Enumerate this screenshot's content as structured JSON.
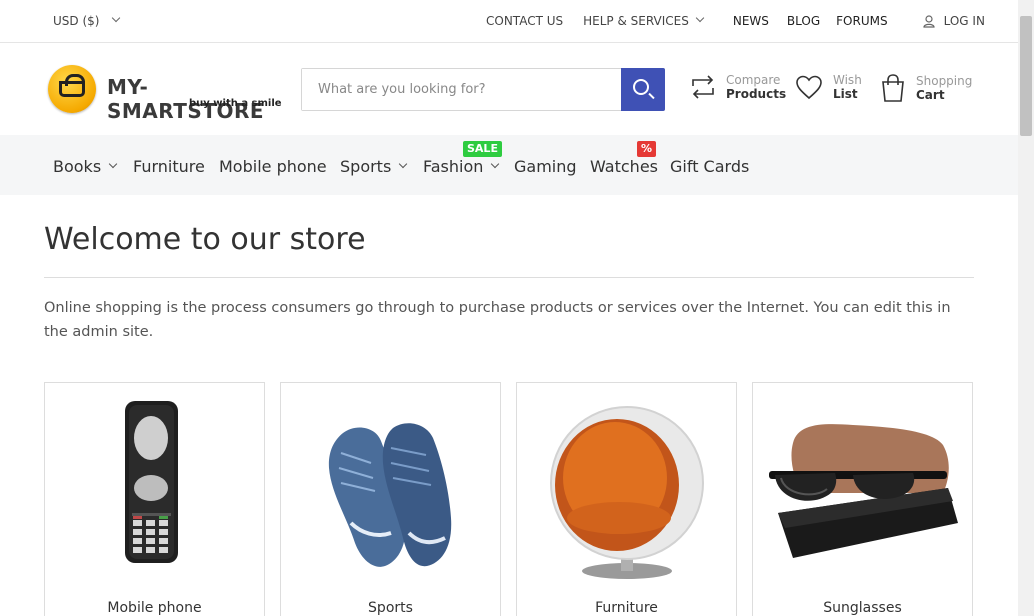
{
  "topbar": {
    "currency": "USD ($)",
    "contact": "CONTACT US",
    "help": "HELP & SERVICES",
    "news": "NEWS",
    "blog": "BLOG",
    "forums": "FORUMS",
    "login": "LOG IN"
  },
  "header": {
    "logo_name": "MY-SMARTSTORE",
    "logo_tagline": "buy with a smile",
    "search_placeholder": "What are you looking for?",
    "compare_small": "Compare",
    "compare_big": "Products",
    "wish_small": "Wish",
    "wish_big": "List",
    "cart_small": "Shopping",
    "cart_big": "Cart"
  },
  "nav": {
    "items": [
      {
        "label": "Books"
      },
      {
        "label": "Furniture"
      },
      {
        "label": "Mobile phone"
      },
      {
        "label": "Sports"
      },
      {
        "label": "Fashion",
        "badge": "SALE"
      },
      {
        "label": "Gaming"
      },
      {
        "label": "Watches",
        "badge": "%"
      },
      {
        "label": "Gift Cards"
      }
    ],
    "colors": {
      "sale": "#2ecc40",
      "percent": "#e53935"
    }
  },
  "main": {
    "title": "Welcome to our store",
    "intro": "Online shopping is the process consumers go through to purchase products or services over the Internet. You can edit this in the admin site.",
    "categories": [
      {
        "name": "Mobile phone"
      },
      {
        "name": "Sports"
      },
      {
        "name": "Furniture"
      },
      {
        "name": "Sunglasses"
      }
    ]
  },
  "colors": {
    "accent": "#3f51b5",
    "nav_bg": "#f5f6f7"
  }
}
